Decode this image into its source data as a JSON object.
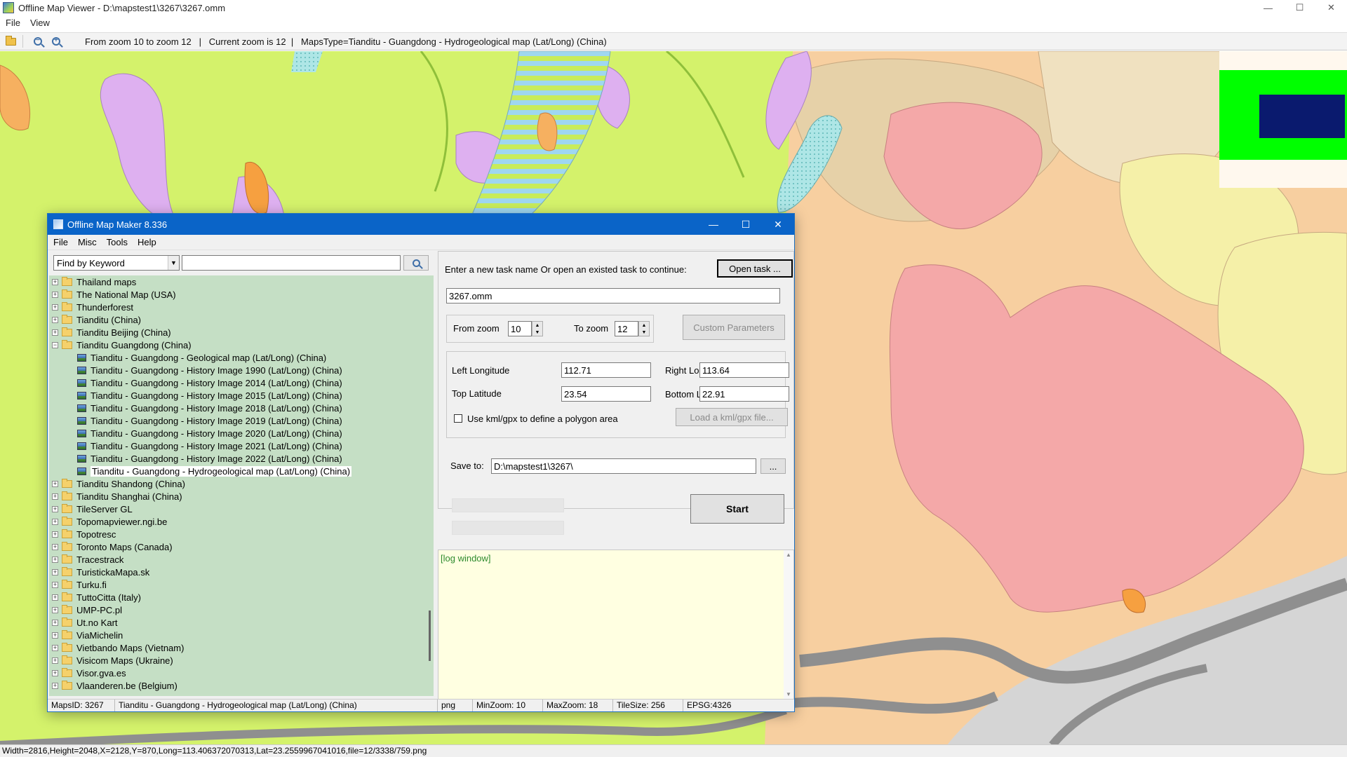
{
  "viewer": {
    "title": "Offline Map Viewer - D:\\mapstest1\\3267\\3267.omm",
    "menu": [
      "File",
      "View"
    ],
    "toolbar_info": "From zoom 10 to zoom 12   |   Current zoom is 12  |   MapsType=Tianditu - Guangdong - Hydrogeological map (Lat/Long) (China)",
    "status": "Width=2816,Height=2048,X=2128,Y=870,Long=113.406372070313,Lat=23.2559967041016,file=12/3338/759.png",
    "controls": {
      "minimize": "—",
      "maximize": "☐",
      "close": "✕"
    }
  },
  "maker": {
    "title": "Offline Map Maker 8.336",
    "menu": [
      "File",
      "Misc",
      "Tools",
      "Help"
    ],
    "find_select": "Find by Keyword",
    "keyword_value": "",
    "tree": [
      {
        "type": "folder",
        "expand": "+",
        "label": "Thailand maps"
      },
      {
        "type": "folder",
        "expand": "+",
        "label": "The National Map (USA)"
      },
      {
        "type": "folder",
        "expand": "+",
        "label": "Thunderforest"
      },
      {
        "type": "folder",
        "expand": "+",
        "label": "Tianditu (China)"
      },
      {
        "type": "folder",
        "expand": "+",
        "label": "Tianditu Beijing (China)"
      },
      {
        "type": "folder",
        "expand": "−",
        "label": "Tianditu Guangdong (China)"
      },
      {
        "type": "item",
        "label": "Tianditu - Guangdong - Geological map (Lat/Long) (China)"
      },
      {
        "type": "item",
        "label": "Tianditu - Guangdong - History Image 1990 (Lat/Long) (China)"
      },
      {
        "type": "item",
        "label": "Tianditu - Guangdong - History Image 2014 (Lat/Long) (China)"
      },
      {
        "type": "item",
        "label": "Tianditu - Guangdong - History Image 2015 (Lat/Long) (China)"
      },
      {
        "type": "item",
        "label": "Tianditu - Guangdong - History Image 2018 (Lat/Long) (China)"
      },
      {
        "type": "item",
        "label": "Tianditu - Guangdong - History Image 2019 (Lat/Long) (China)"
      },
      {
        "type": "item",
        "label": "Tianditu - Guangdong - History Image 2020 (Lat/Long) (China)"
      },
      {
        "type": "item",
        "label": "Tianditu - Guangdong - History Image 2021 (Lat/Long) (China)"
      },
      {
        "type": "item",
        "label": "Tianditu - Guangdong - History Image 2022 (Lat/Long) (China)"
      },
      {
        "type": "item",
        "label": "Tianditu - Guangdong - Hydrogeological map (Lat/Long) (China)",
        "selected": true
      },
      {
        "type": "folder",
        "expand": "+",
        "label": "Tianditu Shandong (China)"
      },
      {
        "type": "folder",
        "expand": "+",
        "label": "Tianditu Shanghai (China)"
      },
      {
        "type": "folder",
        "expand": "+",
        "label": "TileServer GL"
      },
      {
        "type": "folder",
        "expand": "+",
        "label": "Topomapviewer.ngi.be"
      },
      {
        "type": "folder",
        "expand": "+",
        "label": "Topotresc"
      },
      {
        "type": "folder",
        "expand": "+",
        "label": "Toronto Maps (Canada)"
      },
      {
        "type": "folder",
        "expand": "+",
        "label": "Tracestrack"
      },
      {
        "type": "folder",
        "expand": "+",
        "label": "TuristickaMapa.sk"
      },
      {
        "type": "folder",
        "expand": "+",
        "label": "Turku.fi"
      },
      {
        "type": "folder",
        "expand": "+",
        "label": "TuttoCitta (Italy)"
      },
      {
        "type": "folder",
        "expand": "+",
        "label": "UMP-PC.pl"
      },
      {
        "type": "folder",
        "expand": "+",
        "label": "Ut.no Kart"
      },
      {
        "type": "folder",
        "expand": "+",
        "label": "ViaMichelin"
      },
      {
        "type": "folder",
        "expand": "+",
        "label": "Vietbando Maps (Vietnam)"
      },
      {
        "type": "folder",
        "expand": "+",
        "label": "Visicom Maps (Ukraine)"
      },
      {
        "type": "folder",
        "expand": "+",
        "label": "Visor.gva.es"
      },
      {
        "type": "folder",
        "expand": "+",
        "label": "Vlaanderen.be (Belgium)"
      }
    ],
    "task": {
      "prompt": "Enter a new task name Or open an existed task to continue:",
      "open_task": "Open task ...",
      "task_name": "3267.omm",
      "from_zoom_label": "From zoom",
      "from_zoom": "10",
      "to_zoom_label": "To zoom",
      "to_zoom": "12",
      "custom_params": "Custom Parameters",
      "left_lon_label": "Left Longitude",
      "left_lon": "112.71",
      "right_lon_label": "Right Longitude",
      "right_lon": "113.64",
      "top_lat_label": "Top Latitude",
      "top_lat": "23.54",
      "bottom_lat_label": "Bottom Latitude",
      "bottom_lat": "22.91",
      "kml_label": "Use kml/gpx to define a polygon area",
      "load_kml": "Load a kml/gpx file...",
      "save_to_label": "Save to:",
      "save_to": "D:\\mapstest1\\3267\\",
      "browse": "...",
      "start": "Start",
      "log": "[log window]"
    },
    "status": {
      "maps_id": "MapsID: 3267",
      "map_name": "Tianditu - Guangdong - Hydrogeological map (Lat/Long) (China)",
      "format": "png",
      "min_zoom": "MinZoom: 10",
      "max_zoom": "MaxZoom: 18",
      "tile_size": "TileSize: 256",
      "epsg": "EPSG:4326"
    },
    "controls": {
      "minimize": "—",
      "maximize": "☐",
      "close": "✕"
    }
  },
  "colors": {
    "titlebar_active": "#0a64c8",
    "tree_bg": "#c5dfc5",
    "log_bg": "#ffffe1",
    "log_text": "#2e8b2e",
    "map_base": "#d4f26b",
    "map_pink": "#f4a8a8",
    "map_purple": "#deb0f0",
    "map_peach": "#f7cfa0",
    "map_gray": "#8f8f8f"
  }
}
